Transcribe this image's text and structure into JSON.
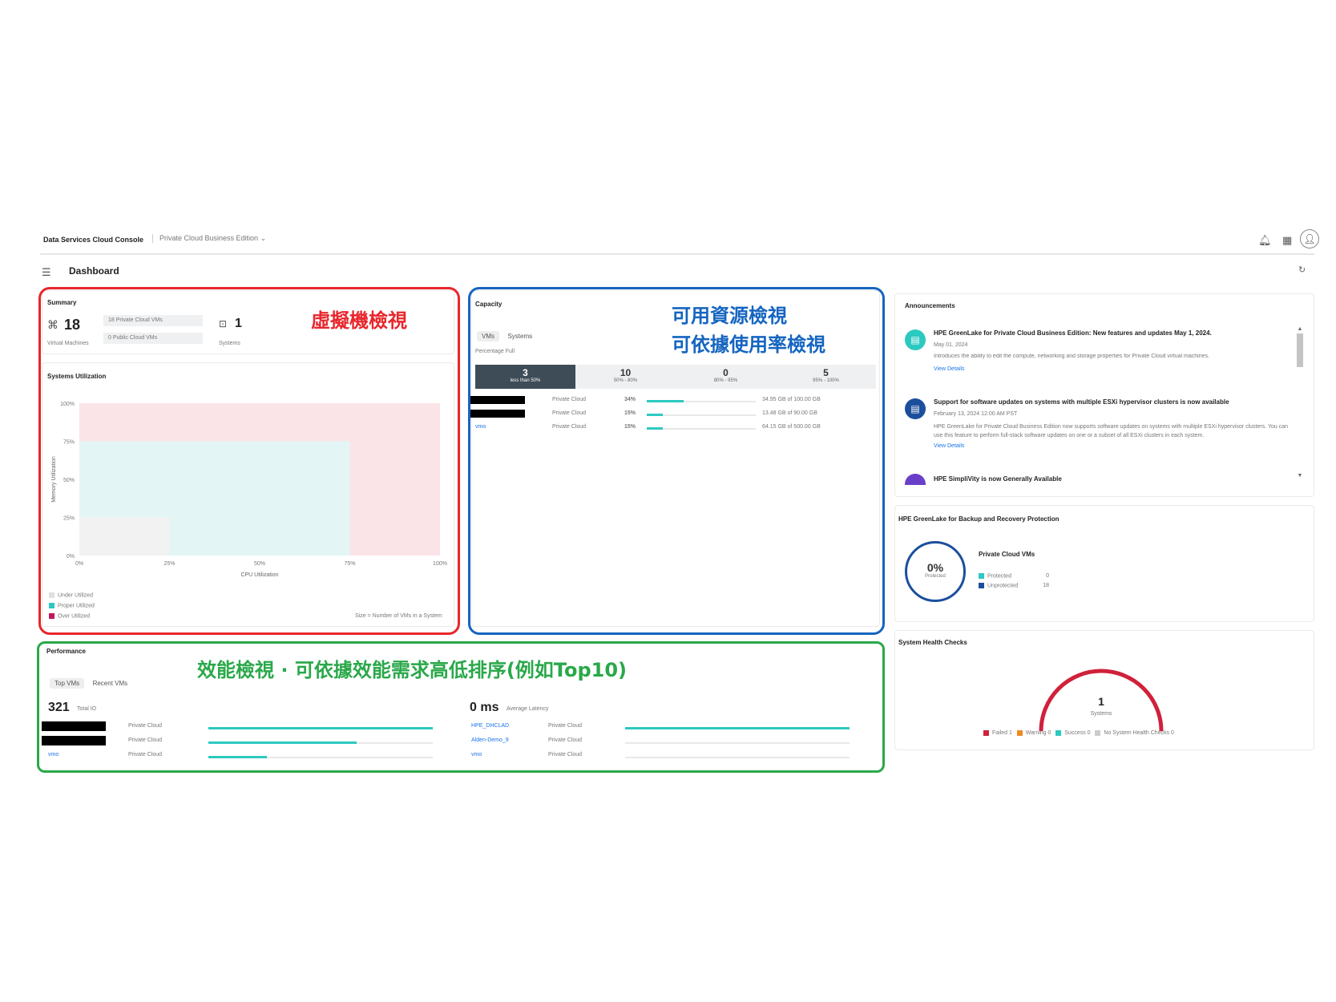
{
  "topbar": {
    "brand": "Data Services Cloud Console",
    "edition": "Private Cloud Business Edition",
    "page_title": "Dashboard"
  },
  "summary": {
    "title": "Summary",
    "vm_count": "18",
    "vm_label": "Virtual Machines",
    "private_vms": "18 Private Cloud VMs",
    "public_vms": "0 Public Cloud VMs",
    "systems_count": "1",
    "systems_label": "Systems"
  },
  "utilization": {
    "title": "Systems Utilization",
    "ylabel": "Memory Utilization",
    "xlabel": "CPU Utilization",
    "yticks": [
      "100%",
      "75%",
      "50%",
      "25%",
      "0%"
    ],
    "xticks": [
      "0%",
      "25%",
      "50%",
      "75%",
      "100%"
    ],
    "legend": [
      "Under Utilized",
      "Proper Utilized",
      "Over Utilized"
    ],
    "note": "Size = Number of VMs in a System",
    "colors": {
      "under": "#f2f2f2",
      "proper": "#e3f6f5",
      "over": "#fbe4e8"
    }
  },
  "annotations": {
    "vm_view": "虛擬機檢視",
    "capacity_view_1": "可用資源檢視",
    "capacity_view_2": "可依據使用率檢視",
    "perf_view": "效能檢視 · 可依據效能需求高低排序(例如Top10)"
  },
  "capacity": {
    "title": "Capacity",
    "tabs": [
      "VMs",
      "Systems"
    ],
    "percentage_label": "Percentage Full",
    "buckets": [
      {
        "count": "3",
        "label": "less than 50%"
      },
      {
        "count": "10",
        "label": "50% - 80%"
      },
      {
        "count": "0",
        "label": "80% - 95%"
      },
      {
        "count": "5",
        "label": "95% - 100%"
      }
    ],
    "rows": [
      {
        "type": "Private Cloud",
        "pct": "34%",
        "fill": 0.34,
        "size": "34.95 GB of 100.00 GB"
      },
      {
        "type": "Private Cloud",
        "pct": "15%",
        "fill": 0.15,
        "size": "13.48 GB of 90.00 GB"
      },
      {
        "type": "Private Cloud",
        "pct": "15%",
        "fill": 0.15,
        "size": "64.15 GB of 500.00 GB"
      }
    ],
    "vm_link": "vmo"
  },
  "announcements": {
    "title": "Announcements",
    "items": [
      {
        "title": "HPE GreenLake for Private Cloud Business Edition: New features and updates May 1, 2024.",
        "date": "May 01, 2024",
        "body": "Introduces the ability to edit the compute, networking and storage properties for Private Cloud virtual machines.",
        "link": "View Details"
      },
      {
        "title": "Support for software updates on systems with multiple ESXi hypervisor clusters is now available",
        "date": "February 13, 2024 12:00 AM PST",
        "body": "HPE GreenLake for Private Cloud Business Edition now supports software updates on systems with multiple ESXi hypervisor clusters. You can use this feature to perform full-stack software updates on one or a subset of all ESXi clusters in each system.",
        "link": "View Details"
      },
      {
        "title": "HPE SimpliVity is now Generally Available"
      }
    ]
  },
  "backup": {
    "title": "HPE GreenLake for Backup and Recovery Protection",
    "pct": "0%",
    "pct_label": "Protected",
    "subtitle": "Private Cloud VMs",
    "protected_label": "Protected",
    "protected_value": "0",
    "unprotected_label": "Unprotected",
    "unprotected_value": "18",
    "colors": {
      "protected": "#2cc9c0",
      "unprotected": "#1b4f9c"
    }
  },
  "health": {
    "title": "System Health Checks",
    "count": "1",
    "count_label": "Systems",
    "legend": [
      {
        "label": "Failed 1",
        "color": "#d0213b"
      },
      {
        "label": "Warning 0",
        "color": "#f08a24"
      },
      {
        "label": "Success 0",
        "color": "#2cc9c0"
      },
      {
        "label": "No System Health Checks 0",
        "color": "#cccccc"
      }
    ]
  },
  "performance": {
    "title": "Performance",
    "tabs": [
      "Top VMs",
      "Recent VMs"
    ],
    "iops_value": "321",
    "iops_label": "Total IO",
    "latency_value": "0 ms",
    "latency_label": "Average Latency",
    "left_rows": [
      {
        "type": "Private Cloud",
        "fill": 1.0
      },
      {
        "type": "Private Cloud",
        "fill": 0.66
      },
      {
        "type": "Private Cloud",
        "fill": 0.26
      }
    ],
    "left_link": "vmo",
    "right_rows": [
      {
        "name": "HPE_DHCLAD",
        "type": "Private Cloud",
        "fill": 1.0
      },
      {
        "name": "Alden-Demo_9",
        "type": "Private Cloud",
        "fill": 0.0
      },
      {
        "name": "vmo",
        "type": "Private Cloud",
        "fill": 0.0
      }
    ]
  }
}
